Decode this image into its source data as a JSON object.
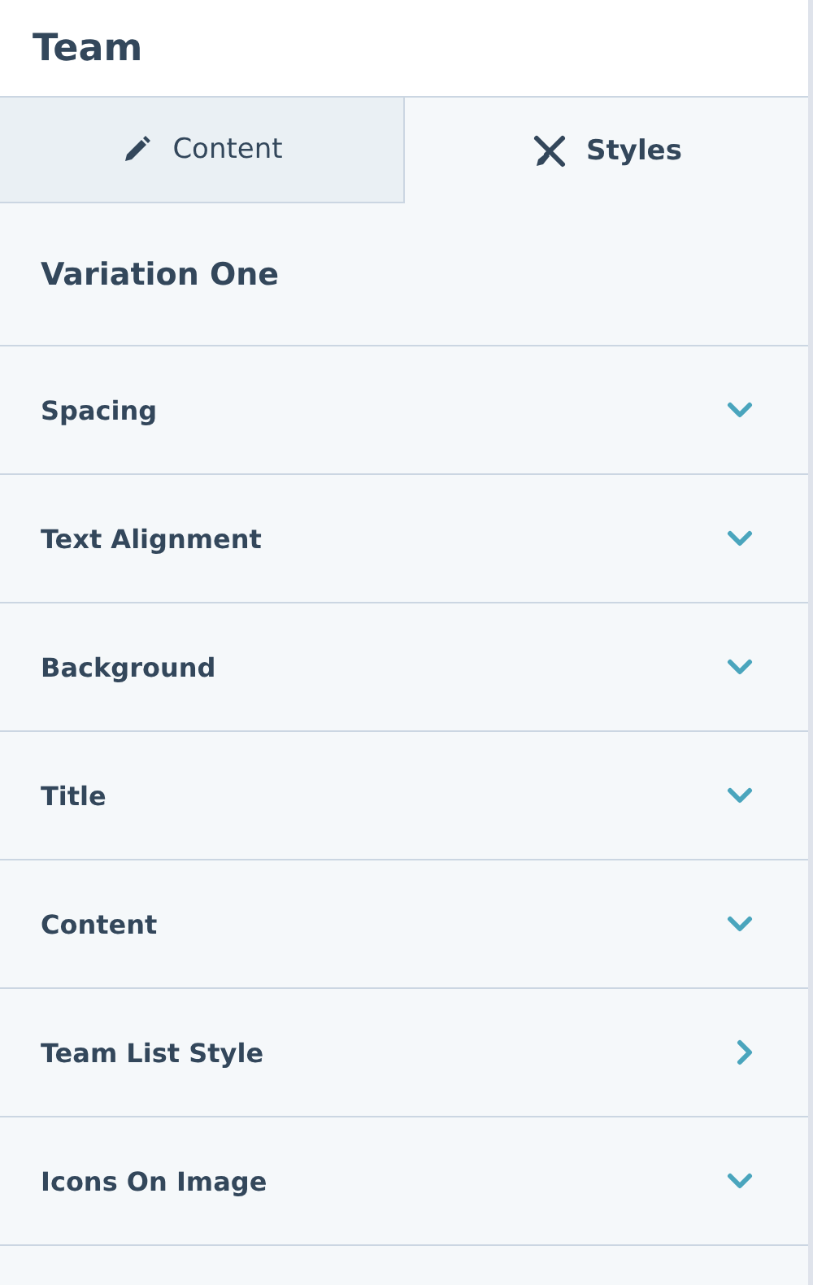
{
  "header": {
    "title": "Team"
  },
  "tabs": [
    {
      "label": "Content",
      "selected": false
    },
    {
      "label": "Styles",
      "selected": true
    }
  ],
  "section_title": "Variation One",
  "groups": [
    {
      "label": "Spacing",
      "kind": "accordion"
    },
    {
      "label": "Text Alignment",
      "kind": "accordion"
    },
    {
      "label": "Background",
      "kind": "accordion"
    },
    {
      "label": "Title",
      "kind": "accordion"
    },
    {
      "label": "Content",
      "kind": "accordion"
    },
    {
      "label": "Team List Style",
      "kind": "submenu"
    },
    {
      "label": "Icons On Image",
      "kind": "accordion"
    }
  ]
}
